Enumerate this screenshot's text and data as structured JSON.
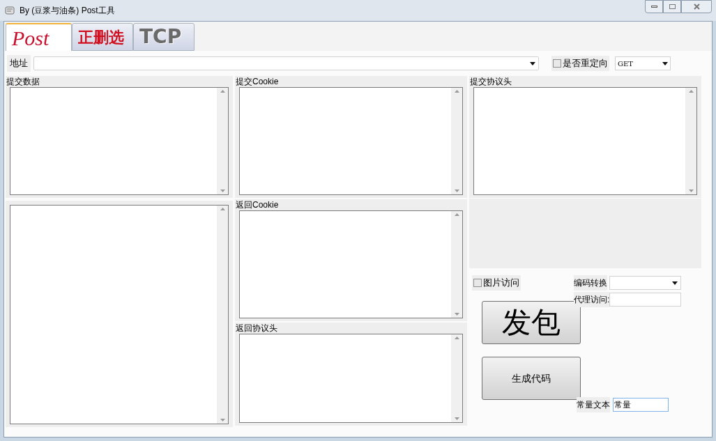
{
  "window": {
    "title": "By (豆浆与油条) Post工具"
  },
  "tabs": [
    {
      "label": "Post",
      "selected": true
    },
    {
      "label": "正删选",
      "selected": false
    },
    {
      "label": "TCP",
      "selected": false
    }
  ],
  "address": {
    "label": "地址"
  },
  "redirect": {
    "label": "是否重定向",
    "checked": false
  },
  "method": {
    "value": "GET"
  },
  "submit_data": {
    "label": "提交数据"
  },
  "submit_cookie": {
    "label": "提交Cookie"
  },
  "submit_headers": {
    "label": "提交协议头"
  },
  "return_cookie": {
    "label": "返回Cookie"
  },
  "return_headers": {
    "label": "返回协议头"
  },
  "image_access": {
    "label": "图片访问",
    "checked": false
  },
  "encoding": {
    "label": "编码转换"
  },
  "proxy": {
    "label": "代理访问:"
  },
  "send_button": {
    "label": "发包"
  },
  "generate_button": {
    "label": "生成代码"
  },
  "constant": {
    "label": "常量文本",
    "value": "常量"
  }
}
